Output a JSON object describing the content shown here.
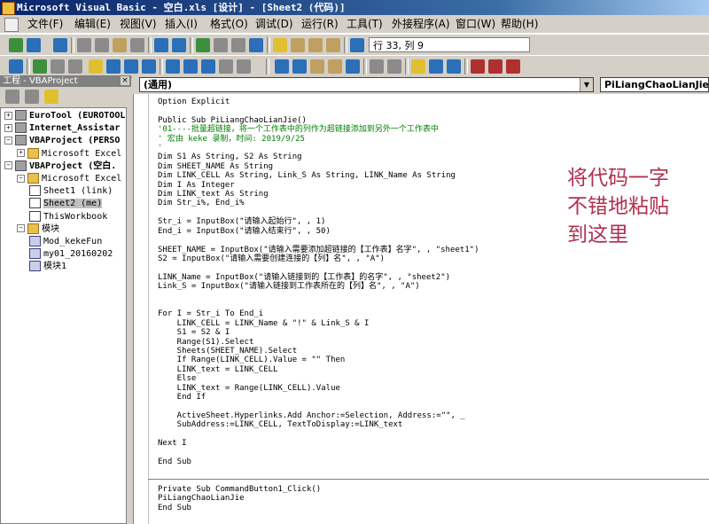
{
  "window": {
    "title": "Microsoft Visual Basic - 空白.xls [设计] - [Sheet2 (代码)]"
  },
  "menu": [
    "文件(F)",
    "编辑(E)",
    "视图(V)",
    "插入(I)",
    "格式(O)",
    "调试(D)",
    "运行(R)",
    "工具(T)",
    "外接程序(A)",
    "窗口(W)",
    "帮助(H)"
  ],
  "toolbar": {
    "cursor_position": "行 33, 列 9"
  },
  "project": {
    "header": "工程 - VBAProject",
    "close_glyph": "×",
    "tree": [
      {
        "label": "EuroTool (EUROTOOL",
        "level": 0,
        "expander": "+",
        "icon": "project-icon",
        "bold": true
      },
      {
        "label": "Internet_Assistar",
        "level": 0,
        "expander": "+",
        "icon": "project-icon",
        "bold": true
      },
      {
        "label": "VBAProject (PERSO",
        "level": 0,
        "expander": "−",
        "icon": "project-icon",
        "bold": true
      },
      {
        "label": "Microsoft Excel",
        "level": 1,
        "expander": "+",
        "icon": "folder-icon",
        "bold": false
      },
      {
        "label": "VBAProject (空白.",
        "level": 0,
        "expander": "−",
        "icon": "project-icon",
        "bold": true
      },
      {
        "label": "Microsoft Excel",
        "level": 1,
        "expander": "−",
        "icon": "folder-icon",
        "bold": false
      },
      {
        "label": "Sheet1 (link)",
        "level": 2,
        "expander": "",
        "icon": "sheet-icon",
        "bold": false
      },
      {
        "label": "Sheet2 (me)",
        "level": 2,
        "expander": "",
        "icon": "sheet-icon",
        "bold": false,
        "selected": true
      },
      {
        "label": "ThisWorkbook",
        "level": 2,
        "expander": "",
        "icon": "workbook-icon",
        "bold": false
      },
      {
        "label": "模块",
        "level": 1,
        "expander": "−",
        "icon": "folder-icon",
        "bold": false
      },
      {
        "label": "Mod_kekeFun",
        "level": 2,
        "expander": "",
        "icon": "module-icon",
        "bold": false
      },
      {
        "label": "my01_20160202",
        "level": 2,
        "expander": "",
        "icon": "module-icon",
        "bold": false
      },
      {
        "label": "模块1",
        "level": 2,
        "expander": "",
        "icon": "module-icon",
        "bold": false
      }
    ]
  },
  "code_window": {
    "object_combo": "(通用)",
    "procedure_combo": "PiLiangChaoLianJie",
    "dropdown_glyph": "▼",
    "lines": [
      {
        "text": "Option Explicit",
        "type": "code"
      },
      {
        "text": "",
        "type": "code"
      },
      {
        "text": "Public Sub PiLiangChaoLianJie()",
        "type": "code"
      },
      {
        "text": "'01----批量超链接，将一个工作表中的列作为超链接添加到另外一个工作表中",
        "type": "comment"
      },
      {
        "text": "' 宏由 keke 录制，时间: 2019/9/25",
        "type": "comment"
      },
      {
        "text": "'",
        "type": "comment"
      },
      {
        "text": "Dim S1 As String, S2 As String",
        "type": "code"
      },
      {
        "text": "Dim SHEET_NAME As String",
        "type": "code"
      },
      {
        "text": "Dim LINK_CELL As String, Link_S As String, LINK_Name As String",
        "type": "code"
      },
      {
        "text": "Dim I As Integer",
        "type": "code"
      },
      {
        "text": "Dim LINK_text As String",
        "type": "code"
      },
      {
        "text": "Dim Str_i%, End_i%",
        "type": "code"
      },
      {
        "text": "",
        "type": "code"
      },
      {
        "text": "Str_i = InputBox(\"请输入起始行\", , 1)",
        "type": "code"
      },
      {
        "text": "End_i = InputBox(\"请输入结束行\", , 50)",
        "type": "code"
      },
      {
        "text": "",
        "type": "code"
      },
      {
        "text": "SHEET_NAME = InputBox(\"请输入需要添加超链接的【工作表】名字\", , \"sheet1\")",
        "type": "code"
      },
      {
        "text": "S2 = InputBox(\"请输入需要创建连接的【列】名\", , \"A\")",
        "type": "code"
      },
      {
        "text": "",
        "type": "code"
      },
      {
        "text": "LINK_Name = InputBox(\"请输入链接到的【工作表】的名字\", , \"sheet2\")",
        "type": "code"
      },
      {
        "text": "Link_S = InputBox(\"请输入链接到工作表所在的【列】名\", , \"A\")",
        "type": "code"
      },
      {
        "text": "",
        "type": "code"
      },
      {
        "text": "",
        "type": "code"
      },
      {
        "text": "For I = Str_i To End_i",
        "type": "code"
      },
      {
        "text": "    LINK_CELL = LINK_Name & \"!\" & Link_S & I",
        "type": "code"
      },
      {
        "text": "    S1 = S2 & I",
        "type": "code"
      },
      {
        "text": "    Range(S1).Select",
        "type": "code"
      },
      {
        "text": "    Sheets(SHEET_NAME).Select",
        "type": "code"
      },
      {
        "text": "    If Range(LINK_CELL).Value = \"\" Then",
        "type": "code"
      },
      {
        "text": "    LINK_text = LINK_CELL",
        "type": "code"
      },
      {
        "text": "    Else",
        "type": "code"
      },
      {
        "text": "    LINK_text = Range(LINK_CELL).Value",
        "type": "code"
      },
      {
        "text": "    End If",
        "type": "code"
      },
      {
        "text": "",
        "type": "code"
      },
      {
        "text": "    ActiveSheet.Hyperlinks.Add Anchor:=Selection, Address:=\"\", _",
        "type": "code"
      },
      {
        "text": "    SubAddress:=LINK_CELL, TextToDisplay:=LINK_text",
        "type": "code"
      },
      {
        "text": "",
        "type": "code"
      },
      {
        "text": "Next I",
        "type": "code"
      },
      {
        "text": "",
        "type": "code"
      },
      {
        "text": "End Sub",
        "type": "code"
      },
      {
        "text": "",
        "type": "code"
      },
      {
        "text": "",
        "type": "code"
      },
      {
        "text": "Private Sub CommandButton1_Click()",
        "type": "code"
      },
      {
        "text": "PiLiangChaoLianJie",
        "type": "code"
      },
      {
        "text": "End Sub",
        "type": "code"
      }
    ]
  },
  "annotation": {
    "lines": [
      "将代码一字",
      "不错地粘贴",
      "到这里"
    ],
    "color": "#b03050"
  },
  "colors": {
    "comment": "#008000",
    "title_start": "#0a246a"
  }
}
